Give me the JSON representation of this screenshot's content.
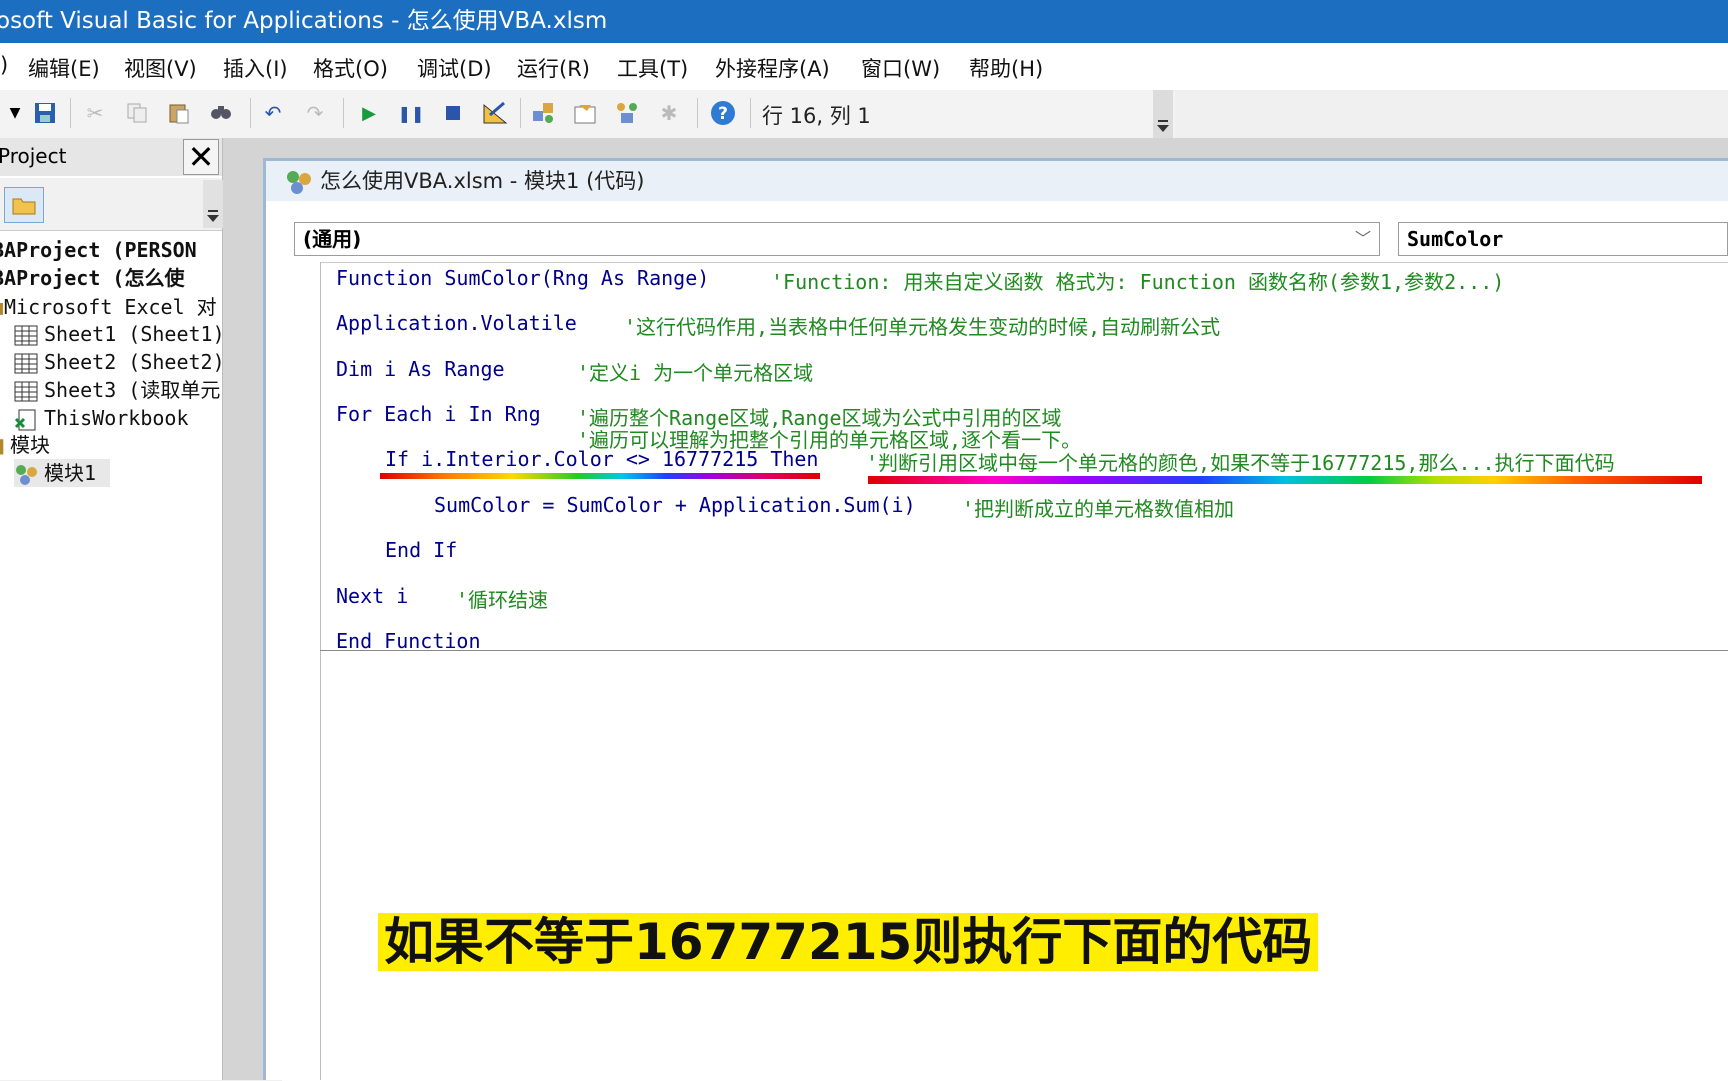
{
  "window": {
    "title": "osoft Visual Basic for Applications - 怎么使用VBA.xlsm"
  },
  "menu": [
    {
      "label": ")"
    },
    {
      "label": "编辑(E)"
    },
    {
      "label": "视图(V)"
    },
    {
      "label": "插入(I)"
    },
    {
      "label": "格式(O)"
    },
    {
      "label": "调试(D)"
    },
    {
      "label": "运行(R)"
    },
    {
      "label": "工具(T)"
    },
    {
      "label": "外接程序(A)"
    },
    {
      "label": "窗口(W)"
    },
    {
      "label": "帮助(H)"
    }
  ],
  "toolbar": {
    "status": "行 16, 列 1",
    "icons": [
      "dropdown-arrow-icon",
      "save-icon",
      "cut-icon",
      "copy-icon",
      "paste-icon",
      "find-icon",
      "undo-icon",
      "redo-icon",
      "run-icon",
      "pause-icon",
      "stop-icon",
      "design-mode-icon",
      "project-explorer-icon",
      "properties-icon",
      "object-browser-icon",
      "toolbox-icon",
      "help-icon"
    ]
  },
  "project_panel": {
    "title": "Project",
    "close_glyph": "✕",
    "tree": [
      {
        "label": "BAProject (PERSON"
      },
      {
        "label": "BAProject (怎么使"
      },
      {
        "label": "Microsoft Excel 对"
      },
      {
        "label": "Sheet1 (Sheet1)"
      },
      {
        "label": "Sheet2 (Sheet2)"
      },
      {
        "label": "Sheet3 (读取单元"
      },
      {
        "label": "ThisWorkbook"
      },
      {
        "label": "模块"
      },
      {
        "label": "模块1"
      }
    ]
  },
  "code_window": {
    "title": "怎么使用VBA.xlsm - 模块1 (代码)",
    "object_combo": "(通用)",
    "proc_combo": "SumColor",
    "lines": [
      {
        "code": "Function SumColor(Rng As Range)",
        "comment": "'Function: 用来自定义函数 格式为: Function 函数名称(参数1,参数2...)"
      },
      {
        "code": "Application.Volatile",
        "comment": "'这行代码作用,当表格中任何单元格发生变动的时候,自动刷新公式"
      },
      {
        "code": "Dim i As Range",
        "comment": "'定义i 为一个单元格区域"
      },
      {
        "code": "For Each i In Rng",
        "comment": "'遍历整个Range区域,Range区域为公式中引用的区域"
      },
      {
        "code": "",
        "comment": "'遍历可以理解为把整个引用的单元格区域,逐个看一下。"
      },
      {
        "code": "If i.Interior.Color <> 16777215 Then",
        "comment": "'判断引用区域中每一个单元格的颜色,如果不等于16777215,那么...执行下面代码"
      },
      {
        "code": "SumColor = SumColor + Application.Sum(i)",
        "comment": "'把判断成立的单元格数值相加"
      },
      {
        "code": "End If",
        "comment": ""
      },
      {
        "code": "Next i",
        "comment": "'循环结速"
      },
      {
        "code": "End Function",
        "comment": ""
      }
    ]
  },
  "subtitle": "如果不等于16777215则执行下面的代码",
  "colors": {
    "titlebar": "#1c6fc0",
    "code_keyword": "#00008b",
    "comment": "#1f8a1f",
    "subtitle_bg": "#ffee00"
  }
}
